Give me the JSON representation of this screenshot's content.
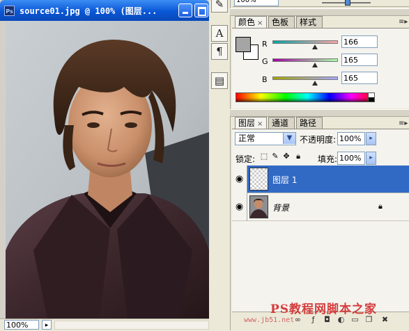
{
  "document": {
    "title": "source01.jpg @ 100% (图层...",
    "app_icon": "Ps",
    "zoom": "100%",
    "status_arrow": "▸"
  },
  "tool_strip": {
    "items": [
      {
        "icon": "brush-preset-icon",
        "glyph": "✎"
      },
      {
        "icon": "character-icon",
        "glyph": "A"
      },
      {
        "icon": "paragraph-icon",
        "glyph": "¶"
      },
      {
        "icon": "layer-comps-icon",
        "glyph": "▤"
      }
    ]
  },
  "navigator": {
    "zoom": "100%"
  },
  "color_panel": {
    "tabs": [
      "颜色",
      "色板",
      "样式"
    ],
    "active_tab": "颜色",
    "close_glyph": "×",
    "foreground": "#a6a5a5",
    "background": "#ffffff",
    "channels": [
      {
        "label": "R",
        "value": "166",
        "fraction": 0.65,
        "gradient": "linear-gradient(to right, #00a5a5, #ffa5a5)"
      },
      {
        "label": "G",
        "value": "165",
        "fraction": 0.65,
        "gradient": "linear-gradient(to right, #a600a5, #a6ffa5)"
      },
      {
        "label": "B",
        "value": "165",
        "fraction": 0.65,
        "gradient": "linear-gradient(to right, #a6a500, #a6a5ff)"
      }
    ],
    "menu_glyph": "≡▸"
  },
  "layers_panel": {
    "tabs": [
      "图层",
      "通道",
      "路径"
    ],
    "active_tab": "图层",
    "close_glyph": "×",
    "menu_glyph": "≡▸",
    "blend_mode": "正常",
    "opacity_label": "不透明度:",
    "opacity": "100%",
    "lock_label": "锁定:",
    "fill_label": "填充:",
    "fill": "100%",
    "layers": [
      {
        "name": "图层 1",
        "selected": true,
        "visible": true
      },
      {
        "name": "背景",
        "selected": false,
        "visible": true,
        "locked": true
      }
    ]
  },
  "watermark": {
    "text": "PS教程网脚本之家",
    "sub": "www.jb51.net"
  },
  "colors": {
    "selection": "#316ac5",
    "titlebar": "#0a57d6"
  }
}
